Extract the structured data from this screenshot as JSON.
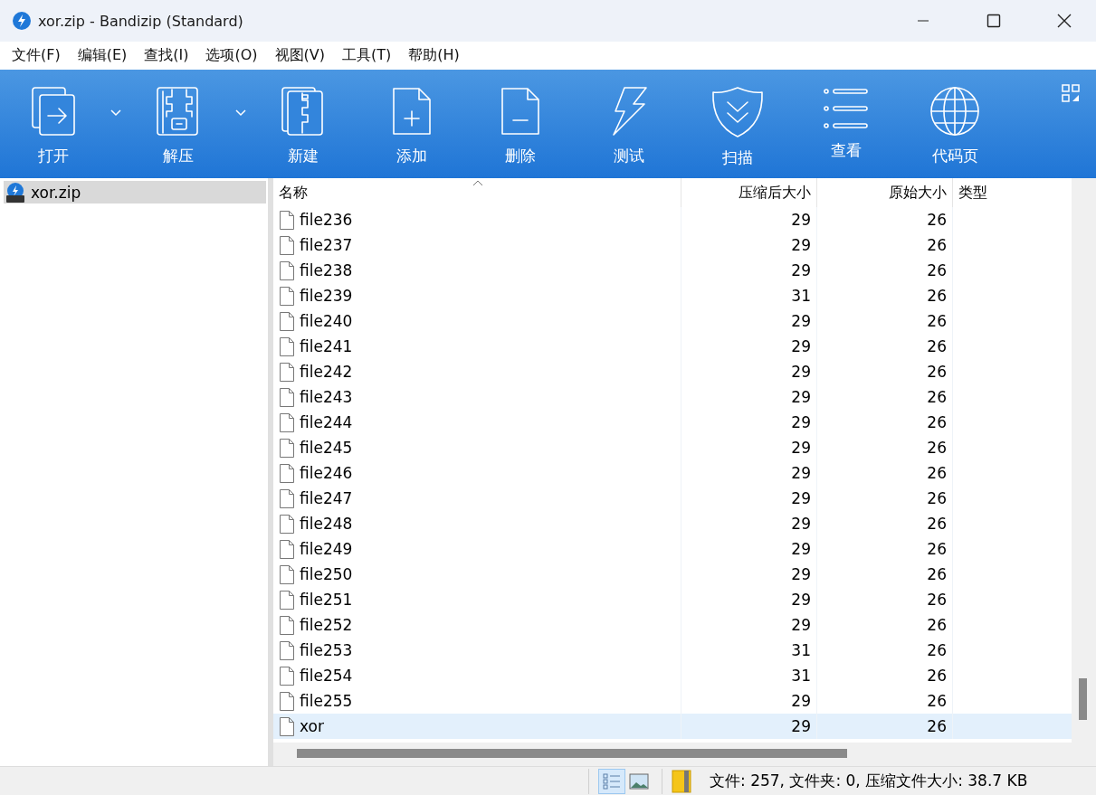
{
  "window": {
    "title": "xor.zip - Bandizip (Standard)"
  },
  "menu": [
    "文件(F)",
    "编辑(E)",
    "查找(I)",
    "选项(O)",
    "视图(V)",
    "工具(T)",
    "帮助(H)"
  ],
  "toolbar": [
    {
      "kind": "open",
      "label": "打开",
      "dropdown": true
    },
    {
      "kind": "extract",
      "label": "解压",
      "dropdown": true
    },
    {
      "kind": "new",
      "label": "新建",
      "dropdown": false
    },
    {
      "kind": "add",
      "label": "添加",
      "dropdown": false
    },
    {
      "kind": "delete",
      "label": "删除",
      "dropdown": false
    },
    {
      "kind": "test",
      "label": "测试",
      "dropdown": false
    },
    {
      "kind": "scan",
      "label": "扫描",
      "dropdown": false
    },
    {
      "kind": "view",
      "label": "查看",
      "dropdown": false
    },
    {
      "kind": "codepage",
      "label": "代码页",
      "dropdown": false
    }
  ],
  "sidebar": {
    "items": [
      {
        "label": "xor.zip",
        "selected": true
      }
    ]
  },
  "table": {
    "columns": [
      "名称",
      "压缩后大小",
      "原始大小",
      "类型"
    ],
    "rows": [
      {
        "name": "file236",
        "packed": "29",
        "size": "26",
        "selected": false
      },
      {
        "name": "file237",
        "packed": "29",
        "size": "26",
        "selected": false
      },
      {
        "name": "file238",
        "packed": "29",
        "size": "26",
        "selected": false
      },
      {
        "name": "file239",
        "packed": "31",
        "size": "26",
        "selected": false
      },
      {
        "name": "file240",
        "packed": "29",
        "size": "26",
        "selected": false
      },
      {
        "name": "file241",
        "packed": "29",
        "size": "26",
        "selected": false
      },
      {
        "name": "file242",
        "packed": "29",
        "size": "26",
        "selected": false
      },
      {
        "name": "file243",
        "packed": "29",
        "size": "26",
        "selected": false
      },
      {
        "name": "file244",
        "packed": "29",
        "size": "26",
        "selected": false
      },
      {
        "name": "file245",
        "packed": "29",
        "size": "26",
        "selected": false
      },
      {
        "name": "file246",
        "packed": "29",
        "size": "26",
        "selected": false
      },
      {
        "name": "file247",
        "packed": "29",
        "size": "26",
        "selected": false
      },
      {
        "name": "file248",
        "packed": "29",
        "size": "26",
        "selected": false
      },
      {
        "name": "file249",
        "packed": "29",
        "size": "26",
        "selected": false
      },
      {
        "name": "file250",
        "packed": "29",
        "size": "26",
        "selected": false
      },
      {
        "name": "file251",
        "packed": "29",
        "size": "26",
        "selected": false
      },
      {
        "name": "file252",
        "packed": "29",
        "size": "26",
        "selected": false
      },
      {
        "name": "file253",
        "packed": "31",
        "size": "26",
        "selected": false
      },
      {
        "name": "file254",
        "packed": "31",
        "size": "26",
        "selected": false
      },
      {
        "name": "file255",
        "packed": "29",
        "size": "26",
        "selected": false
      },
      {
        "name": "xor",
        "packed": "29",
        "size": "26",
        "selected": true
      }
    ]
  },
  "status_bar": {
    "text": "文件: 257, 文件夹: 0, 压缩文件大小: 38.7 KB"
  }
}
